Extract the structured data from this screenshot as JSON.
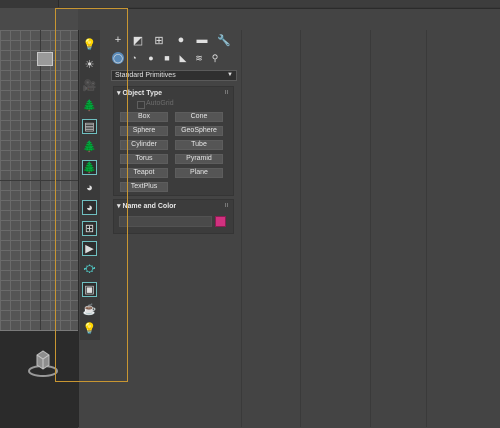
{
  "colors": {
    "accent_teal": "#4fc3c0",
    "highlight_frame": "#c89632",
    "object_color": "#d1317f"
  },
  "toolbar_icons": [
    "lights-icon",
    "sun-icon",
    "camera-icon",
    "foliage-icon",
    "grid-icon",
    "tree-icon",
    "tree-light-icon",
    "spinner-icon",
    "globe-icon",
    "layout-icon",
    "media-icon",
    "camera-rig-icon",
    "window-icon",
    "teapot-icon",
    "bulb-icon"
  ],
  "command_panel": {
    "tabs": [
      {
        "icon": "create-plus-icon",
        "glyph": "+"
      },
      {
        "icon": "modify-icon",
        "glyph": "◩"
      },
      {
        "icon": "hierarchy-icon",
        "glyph": "⊞"
      },
      {
        "icon": "motion-icon",
        "glyph": "●"
      },
      {
        "icon": "display-icon",
        "glyph": "▬"
      },
      {
        "icon": "utilities-icon",
        "glyph": "🔧"
      }
    ],
    "subcategories": [
      {
        "icon": "geometry-icon",
        "glyph": "◯"
      },
      {
        "icon": "shapes-icon",
        "glyph": "◔"
      },
      {
        "icon": "lights-icon",
        "glyph": "●"
      },
      {
        "icon": "cameras-icon",
        "glyph": "■"
      },
      {
        "icon": "helpers-icon",
        "glyph": "◣"
      },
      {
        "icon": "spacewarps-icon",
        "glyph": "≋"
      },
      {
        "icon": "systems-icon",
        "glyph": "⚲"
      }
    ],
    "dropdown_value": "Standard Primitives",
    "object_type": {
      "title": "Object Type",
      "autogrid_label": "AutoGrid",
      "buttons": [
        "Box",
        "Cone",
        "Sphere",
        "GeoSphere",
        "Cylinder",
        "Tube",
        "Torus",
        "Pyramid",
        "Teapot",
        "Plane",
        "TextPlus"
      ]
    },
    "name_and_color": {
      "title": "Name and Color",
      "name_value": ""
    }
  }
}
